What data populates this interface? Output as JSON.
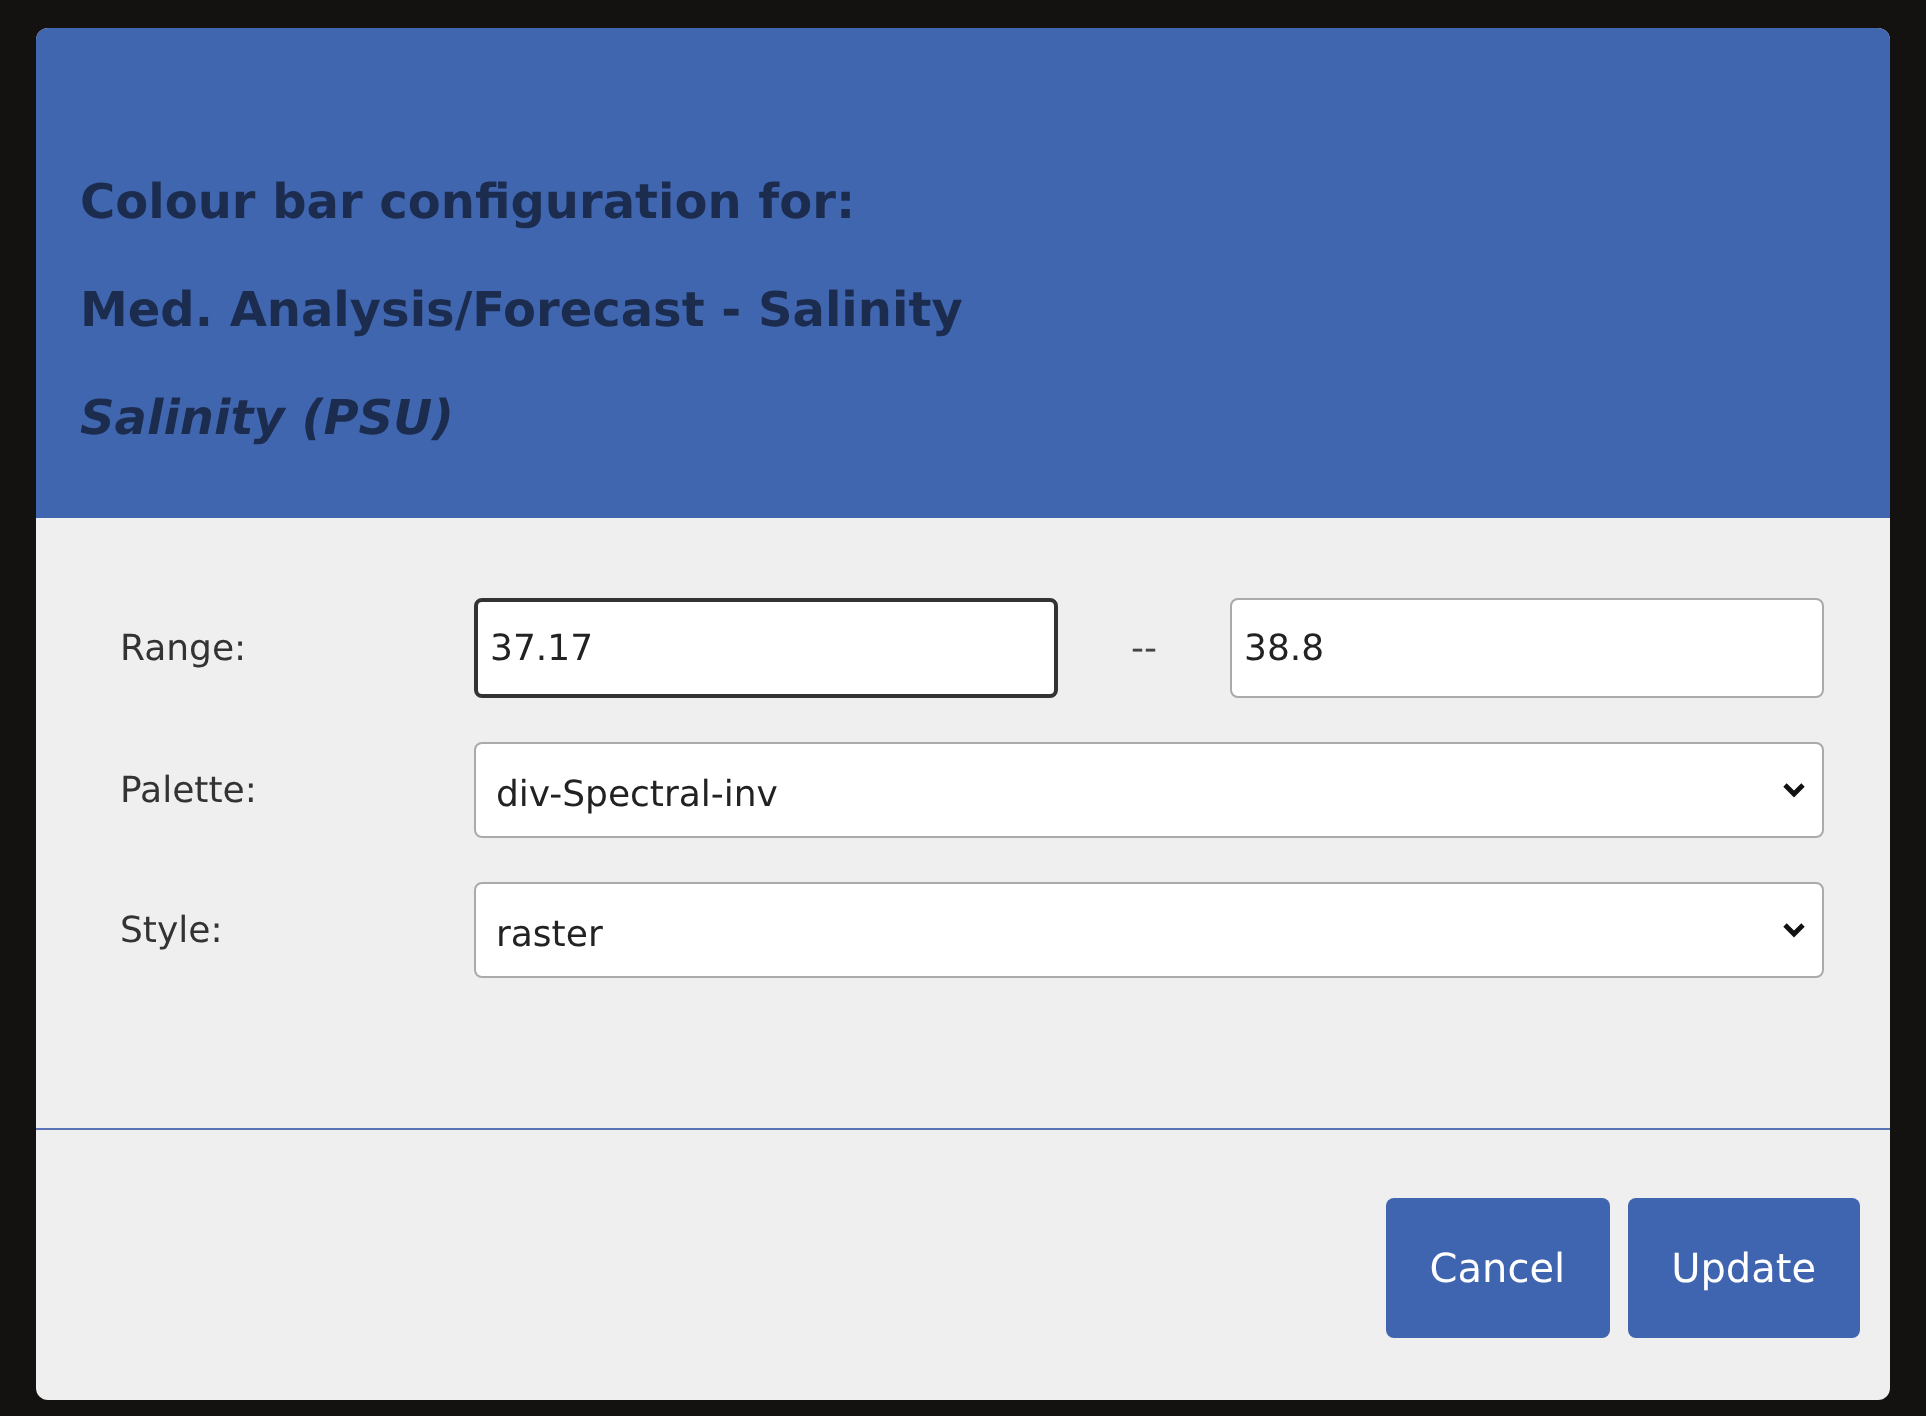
{
  "dialog": {
    "title_lines": [
      "Colour bar configuration for:",
      "Med. Analysis/Forecast - Salinity"
    ],
    "subtitle": "Salinity (PSU)"
  },
  "range": {
    "label": "Range:",
    "min": {
      "value": "37.17",
      "focused": true
    },
    "separator": "--",
    "max": {
      "value": "38.8",
      "focused": false
    }
  },
  "selects": [
    {
      "label": "Palette:",
      "value": "div-Spectral-inv"
    },
    {
      "label": "Style:",
      "value": "raster"
    }
  ],
  "buttons": [
    "Cancel",
    "Update"
  ]
}
